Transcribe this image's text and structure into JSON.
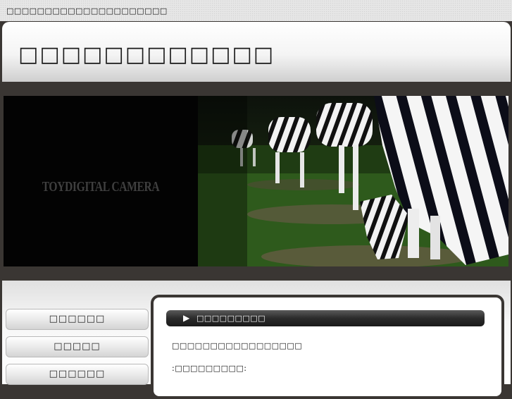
{
  "header": {
    "tagline": "□□□□□□□□□□□□□□□□□□□□□",
    "site_title": "□□□□□□□□□□□□"
  },
  "hero": {
    "logo_text": "TOYDIGITAL CAMERA",
    "photo": "zebra-figurines-on-grass"
  },
  "nav": {
    "items": [
      {
        "label": "□□□□□□"
      },
      {
        "label": "□□□□□"
      },
      {
        "label": "□□□□□□"
      }
    ]
  },
  "content": {
    "section_arrow": "▶",
    "section_title": "□□□□□□□□□",
    "line1": "□□□□□□□□□□□□□□□□□",
    "line2": ":□□□□□□□□□:"
  },
  "colors": {
    "frame": "#3a3633",
    "section_bar": "#2b2b2b",
    "hero_left": "#030303"
  }
}
